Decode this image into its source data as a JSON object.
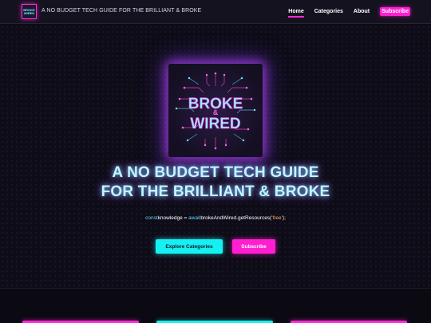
{
  "header": {
    "logo_alt": "BROKE & WIRED",
    "tagline": "A NO BUDGET TECH GUIDE FOR THE BRILLIANT & BROKE",
    "nav": [
      {
        "label": "Home",
        "active": true
      },
      {
        "label": "Categories",
        "active": false
      },
      {
        "label": "About",
        "active": false
      },
      {
        "label": "Subscribe",
        "active": false
      }
    ]
  },
  "hero": {
    "logo_text_top": "BROKE",
    "logo_text_amp": "&",
    "logo_text_bottom": "WIRED",
    "headline_line1": "A NO BUDGET TECH GUIDE",
    "headline_line2": "FOR THE BRILLIANT & BROKE",
    "code": {
      "keyword": "const",
      "variable": "knowledge",
      "equals": " = ",
      "await": "await",
      "call": "brokeAndWired.getResources(",
      "arg": "'free'",
      "end": ");"
    },
    "explore_label": "Explore Categories",
    "subscribe_label": "Subscribe"
  },
  "colors": {
    "magenta": "#ff1fd1",
    "cyan": "#16f0f2",
    "background": "#0d0b14"
  }
}
